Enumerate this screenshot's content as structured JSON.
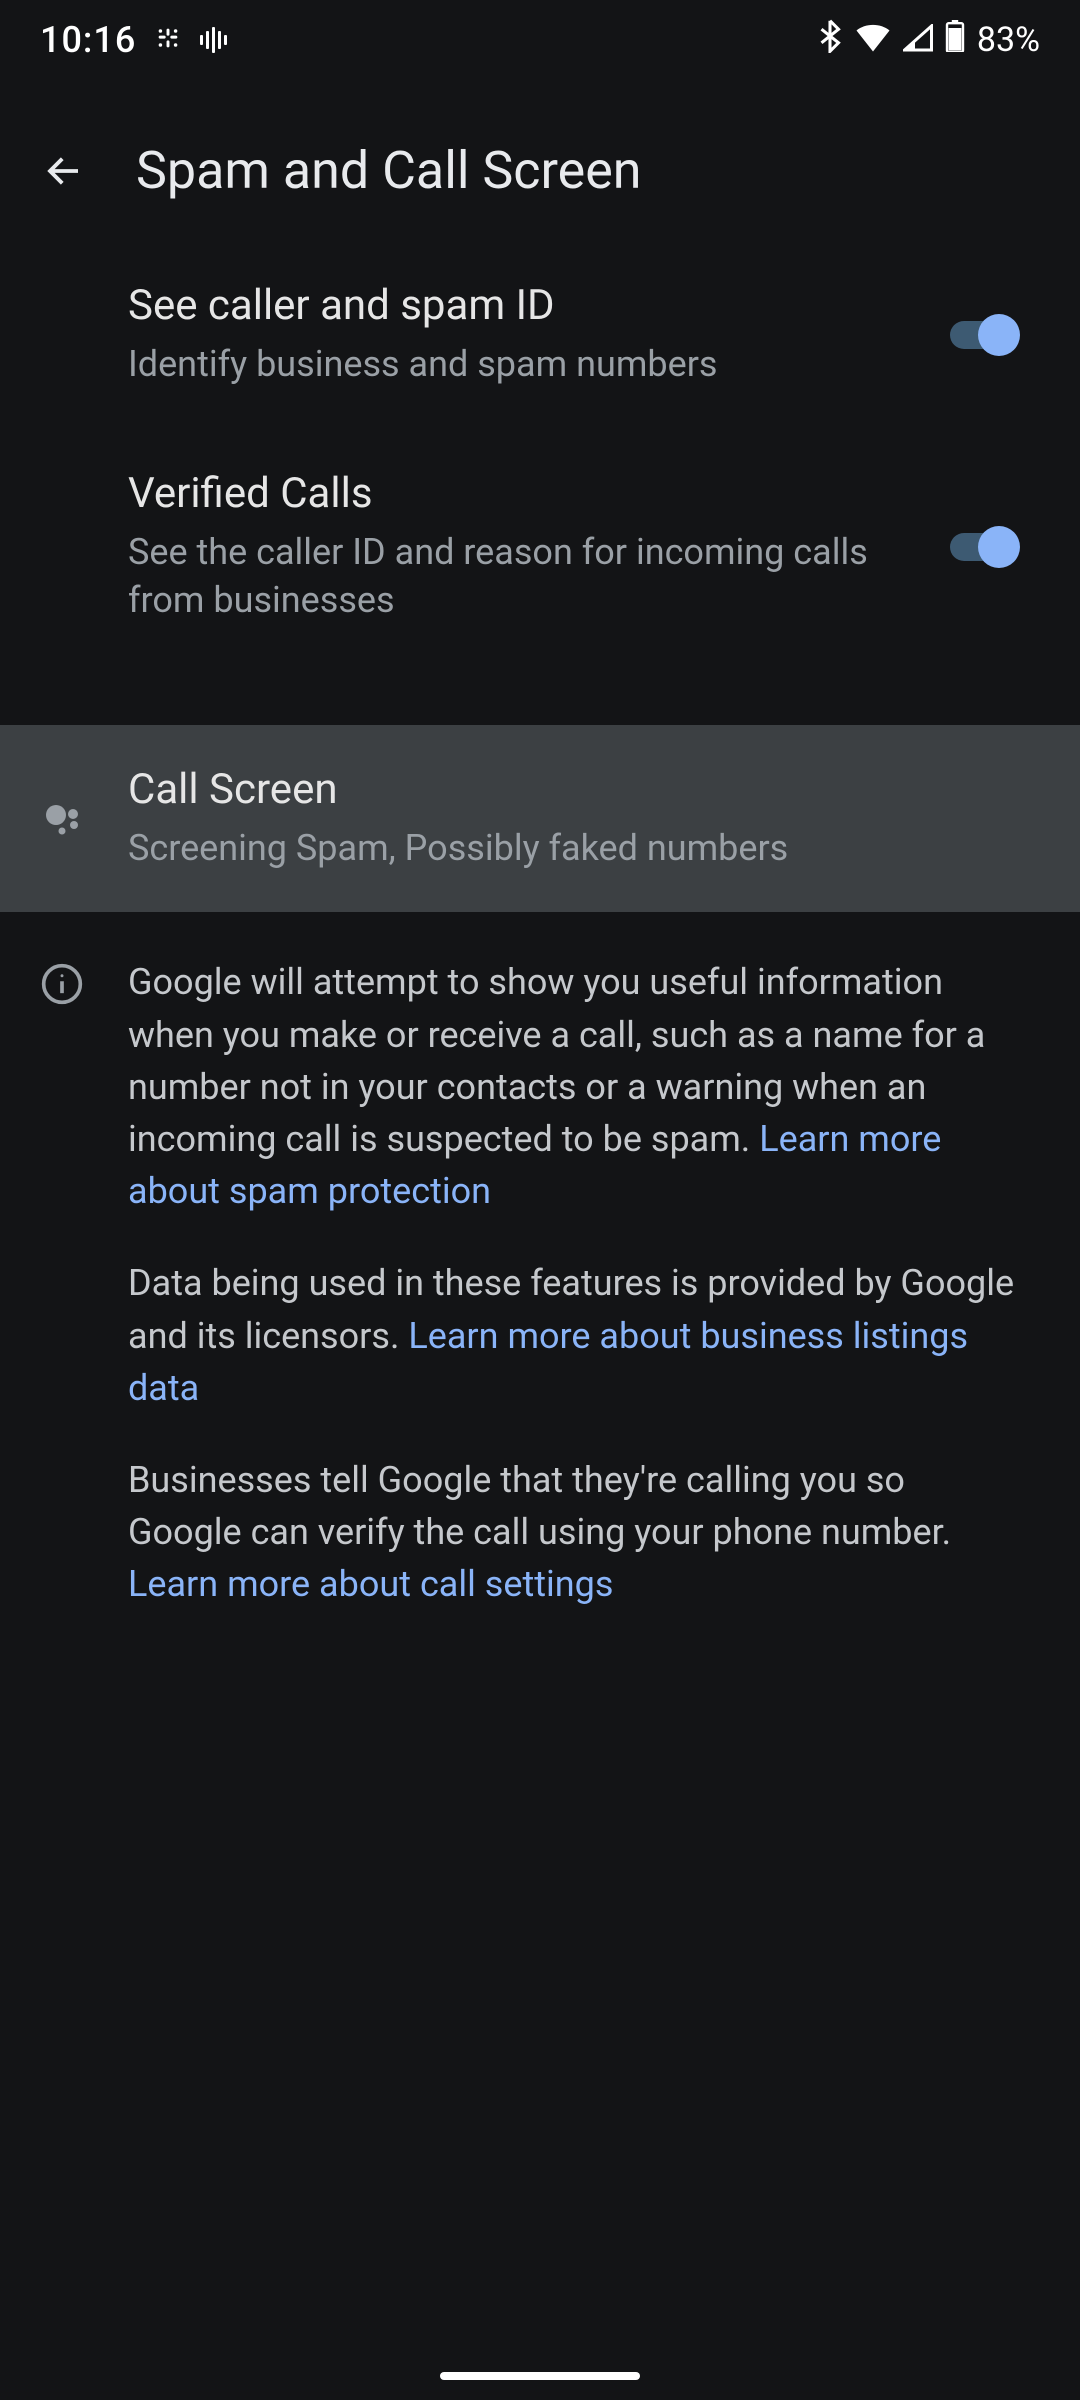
{
  "status": {
    "time": "10:16",
    "battery": "83%"
  },
  "header": {
    "title": "Spam and Call Screen"
  },
  "settings": {
    "callerId": {
      "title": "See caller and spam ID",
      "subtitle": "Identify business and spam numbers",
      "enabled": true
    },
    "verifiedCalls": {
      "title": "Verified Calls",
      "subtitle": "See the caller ID and reason for incoming calls from businesses",
      "enabled": true
    },
    "callScreen": {
      "title": "Call Screen",
      "subtitle": "Screening Spam, Possibly faked numbers"
    }
  },
  "info": {
    "para1_text": "Google will attempt to show you useful information when you make or receive a call, such as a name for a number not in your contacts or a warning when an incoming call is suspected to be spam. ",
    "para1_link": "Learn more about spam protection",
    "para2_text": "Data being used in these features is provided by Google and its licensors. ",
    "para2_link": "Learn more about business listings data",
    "para3_text": "Businesses tell Google that they're calling you so Google can verify the call using your phone number. ",
    "para3_link": "Learn more about call settings"
  }
}
